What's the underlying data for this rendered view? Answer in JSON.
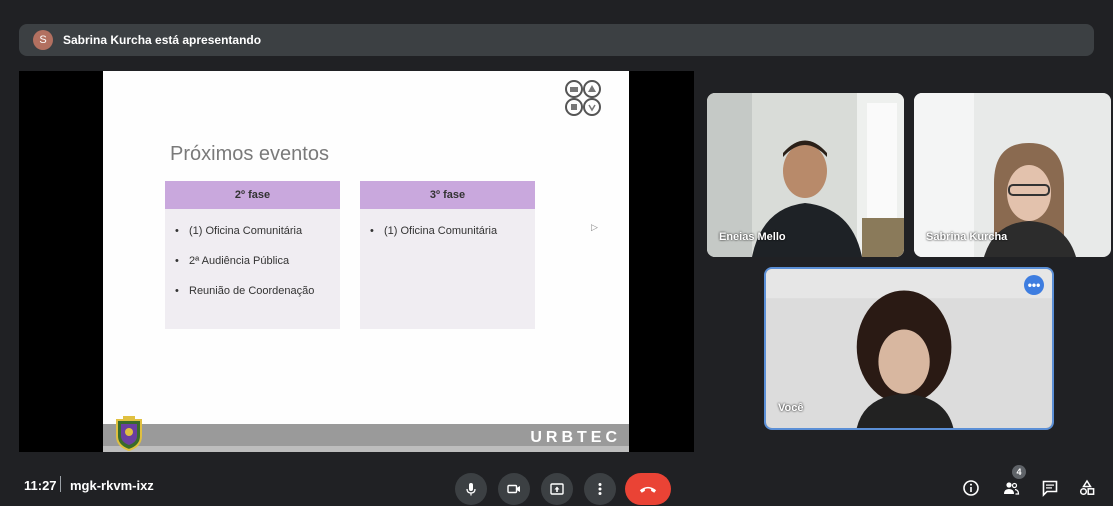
{
  "presenter": {
    "avatar_letter": "S",
    "text": "Sabrina Kurcha está apresentando"
  },
  "slide": {
    "title": "Próximos eventos",
    "phase2": {
      "header": "2º fase",
      "items": [
        "(1) Oficina Comunitária",
        "2ª Audiência Pública",
        "Reunião de Coordenação"
      ]
    },
    "phase3": {
      "header": "3º fase",
      "items": [
        "(1) Oficina Comunitária"
      ]
    },
    "brand": "URBTEC"
  },
  "participants": [
    {
      "name": "Eneias Mello"
    },
    {
      "name": "Sabrina Kurcha"
    },
    {
      "name": "Você"
    }
  ],
  "bottom": {
    "time": "11:27",
    "meeting_code": "mgk-rkvm-ixz",
    "people_count": "4"
  },
  "icons": {
    "mic": "mic-icon",
    "camera": "camera-icon",
    "present": "present-screen-icon",
    "more": "more-vert-icon",
    "end_call": "end-call-icon",
    "info": "info-icon",
    "people": "people-icon",
    "chat": "chat-icon",
    "activities": "activities-icon"
  },
  "colors": {
    "end_call": "#ea4335",
    "phase_header": "#c9a8dd",
    "active_speaker": "#5b8fd6"
  }
}
